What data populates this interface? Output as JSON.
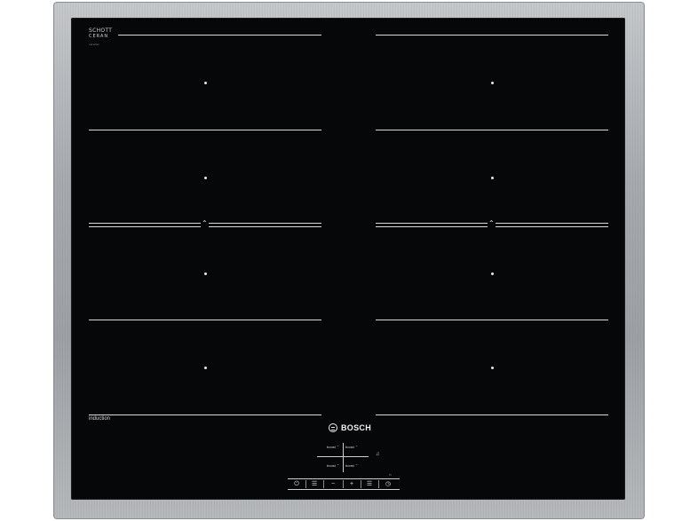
{
  "branding": {
    "glass_brand_line1": "SCHOTT",
    "glass_brand_line2": "CERAN",
    "glass_brand_line3": "ceramic",
    "appliance_brand": "BOSCH",
    "technology_label": "induction"
  },
  "zones": [
    {
      "id": "left-1"
    },
    {
      "id": "left-2"
    },
    {
      "id": "left-3"
    },
    {
      "id": "left-4"
    },
    {
      "id": "right-1"
    },
    {
      "id": "right-2"
    },
    {
      "id": "right-3"
    },
    {
      "id": "right-4"
    }
  ],
  "boost_labels": {
    "top_left": "boost",
    "top_right": "boost",
    "bottom_left": "boost",
    "bottom_right": "boost"
  },
  "controls": {
    "power_icon": "power-lock-icon",
    "zone_icon": "zone-select-icon",
    "minus": "−",
    "plus": "+",
    "zone2_icon": "zone-select-icon",
    "timer_icon": "timer-icon",
    "bell_icon": "bell-icon",
    "flex_icon": "flex-zone-icon"
  },
  "colors": {
    "glass": "#060708",
    "lines": "#d7d9db",
    "frame": "#a8acb0"
  }
}
